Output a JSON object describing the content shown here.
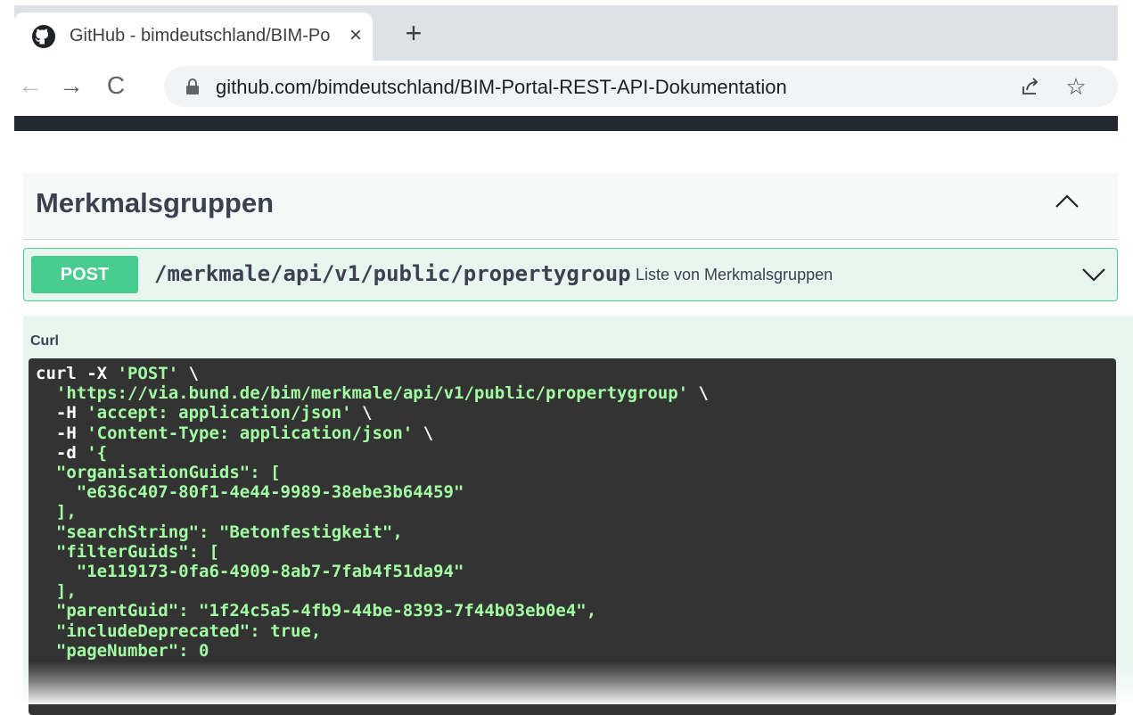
{
  "browser": {
    "tab_title": "GitHub - bimdeutschland/BIM-Po",
    "tab_close": "×",
    "new_tab": "+",
    "back": "←",
    "forward": "→",
    "reload": "C",
    "url": "github.com/bimdeutschland/BIM-Portal-REST-API-Dokumentation",
    "star": "☆"
  },
  "section": {
    "title": "Merkmalsgruppen"
  },
  "operation": {
    "method": "POST",
    "path": "/merkmale/api/v1/public/propertygroup",
    "summary": "Liste von Merkmalsgruppen"
  },
  "curl": {
    "label": "Curl",
    "lines": [
      [
        {
          "t": "curl -X "
        },
        {
          "t": "'POST'",
          "s": 1
        },
        {
          "t": " \\"
        }
      ],
      [
        {
          "t": "  "
        },
        {
          "t": "'https://via.bund.de/bim/merkmale/api/v1/public/propertygroup'",
          "s": 1
        },
        {
          "t": " \\"
        }
      ],
      [
        {
          "t": "  -H "
        },
        {
          "t": "'accept: application/json'",
          "s": 1
        },
        {
          "t": " \\"
        }
      ],
      [
        {
          "t": "  -H "
        },
        {
          "t": "'Content-Type: application/json'",
          "s": 1
        },
        {
          "t": " \\"
        }
      ],
      [
        {
          "t": "  -d "
        },
        {
          "t": "'{",
          "s": 1
        }
      ],
      [
        {
          "t": "  \"organisationGuids\": [",
          "s": 1
        }
      ],
      [
        {
          "t": "    \"e636c407-80f1-4e44-9989-38ebe3b64459\"",
          "s": 1
        }
      ],
      [
        {
          "t": "  ],",
          "s": 1
        }
      ],
      [
        {
          "t": "  \"searchString\": \"Betonfestigkeit\",",
          "s": 1
        }
      ],
      [
        {
          "t": "  \"filterGuids\": [",
          "s": 1
        }
      ],
      [
        {
          "t": "    \"1e119173-0fa6-4909-8ab7-7fab4f51da94\"",
          "s": 1
        }
      ],
      [
        {
          "t": "  ],",
          "s": 1
        }
      ],
      [
        {
          "t": "  \"parentGuid\": \"1f24c5a5-4fb9-44be-8393-7f44b03eb0e4\",",
          "s": 1
        }
      ],
      [
        {
          "t": "  \"includeDeprecated\": true,",
          "s": 1
        }
      ],
      [
        {
          "t": "  \"pageNumber\": 0",
          "s": 1
        }
      ]
    ]
  },
  "colors": {
    "post_green": "#49cc90",
    "code_bg": "#333333",
    "code_string": "#a2fca2"
  }
}
